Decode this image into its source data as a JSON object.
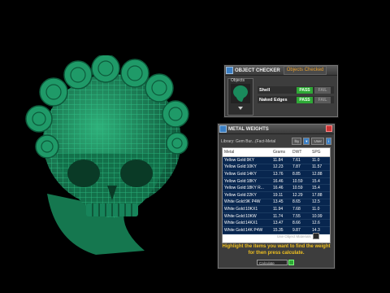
{
  "object_checker": {
    "title": "OBJECT CHECKER",
    "tab": "Objects Checked",
    "objects_label": "Objects",
    "checks": [
      {
        "name": "Shell",
        "pass": "PASS",
        "fail": "FAIL"
      },
      {
        "name": "Naked Edges",
        "pass": "PASS",
        "fail": "FAIL"
      }
    ]
  },
  "metal_weights": {
    "title": "METAL WEIGHTS",
    "library_label": "Library: Gem Bur...(Fact-Metal",
    "controls": [
      "lby",
      "User"
    ],
    "columns": [
      "Metal",
      "Grams",
      "DWT",
      "SPG"
    ],
    "rows": [
      [
        "Yellow Gold:9KY",
        "11.84",
        "7.61",
        "11.0"
      ],
      [
        "Yellow Gold:10KY",
        "12.23",
        "7.87",
        "11.57"
      ],
      [
        "Yellow Gold:14KY",
        "13.76",
        "8.85",
        "12.88"
      ],
      [
        "Yellow Gold:18KY",
        "16.46",
        "10.59",
        "15.4"
      ],
      [
        "Yellow Gold:18KY R...",
        "16.46",
        "10.59",
        "15.4"
      ],
      [
        "Yellow Gold:22KY",
        "19.11",
        "12.29",
        "17.88"
      ],
      [
        "White Gold:9K P4W",
        "13.45",
        "8.65",
        "12.5"
      ],
      [
        "White Gold:10KX1",
        "11.94",
        "7.68",
        "11.0"
      ],
      [
        "White Gold:10KW",
        "11.74",
        "7.55",
        "10.99"
      ],
      [
        "White Gold:14KX1",
        "13.47",
        "8.66",
        "12.6"
      ],
      [
        "White Gold:14K P4W",
        "15.35",
        "9.87",
        "14.3"
      ]
    ],
    "use_materials_label": "Use Object Materials",
    "hint": "Highlight the items you want to find the weight for then press calculate.",
    "calculate_label": "Calculate"
  },
  "colors": {
    "model": "#1a8a5c",
    "pass": "#2ea836",
    "hint": "#f0c020",
    "table_row": "#08264f"
  }
}
